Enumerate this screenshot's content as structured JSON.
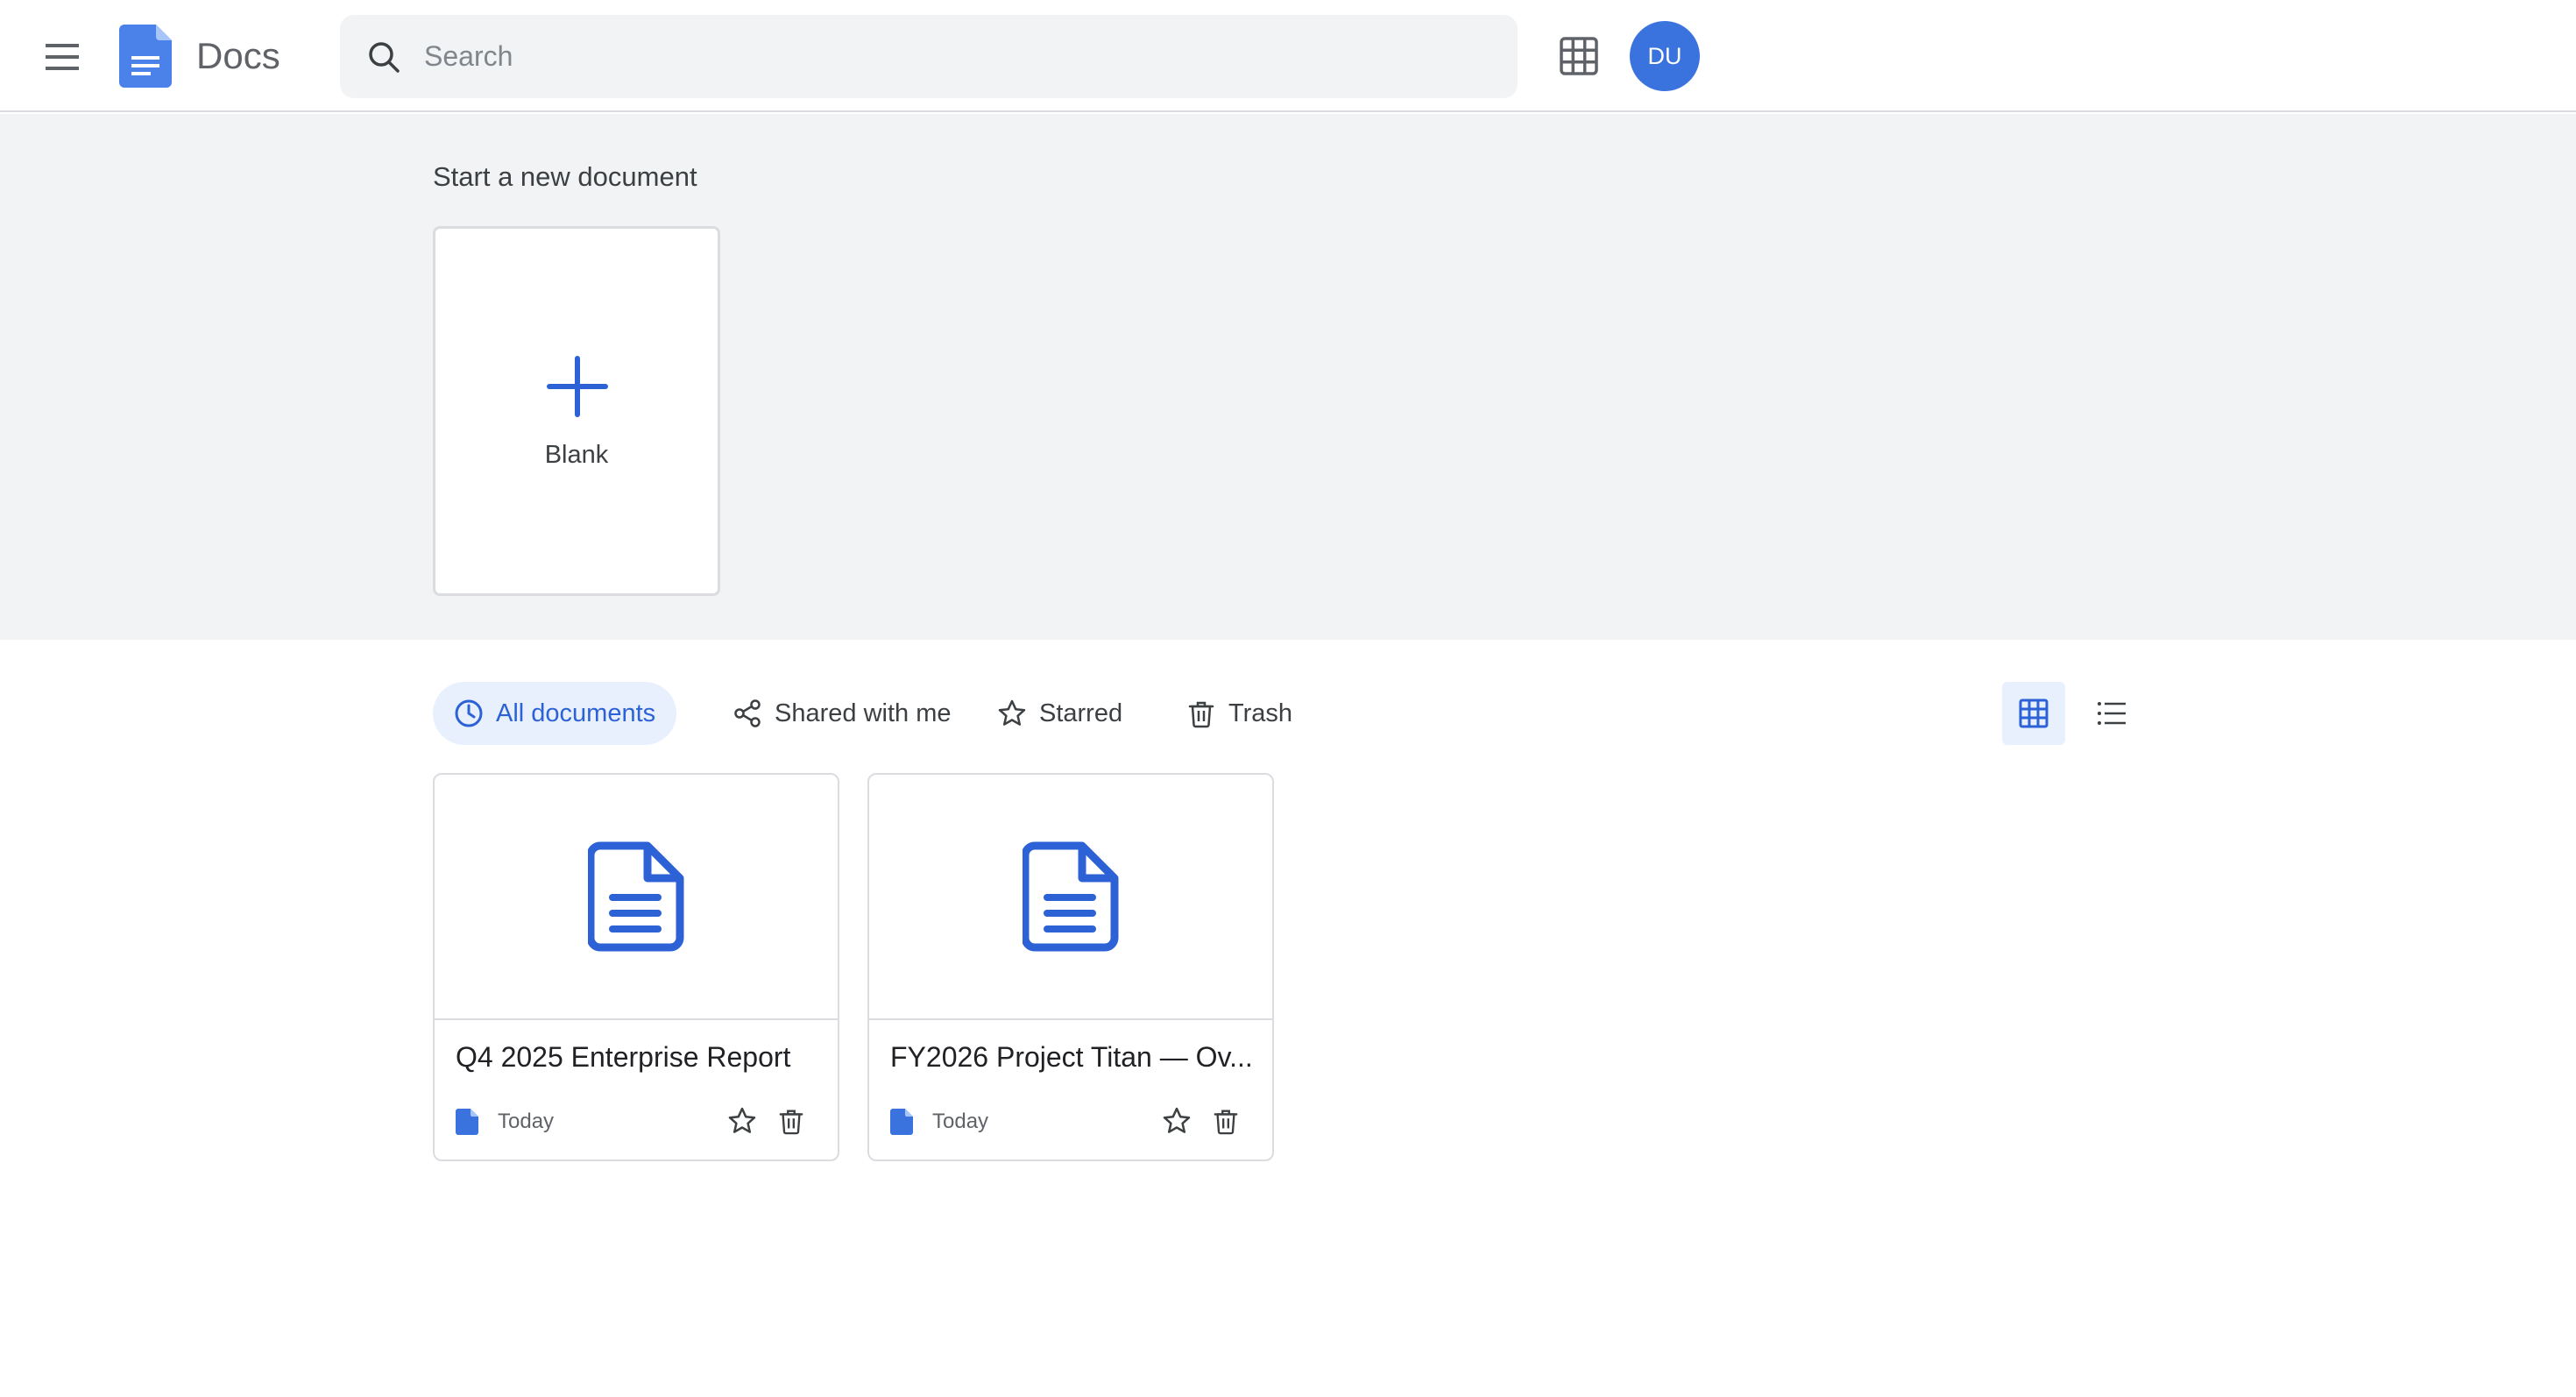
{
  "header": {
    "app_title": "Docs",
    "search_placeholder": "Search",
    "avatar_initials": "DU",
    "menu_icon": "hamburger-menu-icon",
    "apps_icon": "grid-apps-icon",
    "brand_color": "#3a73de"
  },
  "start_section": {
    "title": "Start a new document",
    "blank_label": "Blank"
  },
  "filters": [
    {
      "label": "All documents",
      "icon": "clock-icon",
      "active": true
    },
    {
      "label": "Shared with me",
      "icon": "share-icon",
      "active": false
    },
    {
      "label": "Starred",
      "icon": "star-icon",
      "active": false
    },
    {
      "label": "Trash",
      "icon": "trash-icon",
      "active": false
    }
  ],
  "view_mode": {
    "selected": "grid",
    "options": [
      "grid",
      "list"
    ]
  },
  "documents": [
    {
      "title": "Q4 2025 Enterprise Report",
      "date": "Today"
    },
    {
      "title": "FY2026 Project Titan — Ov...",
      "date": "Today"
    }
  ]
}
